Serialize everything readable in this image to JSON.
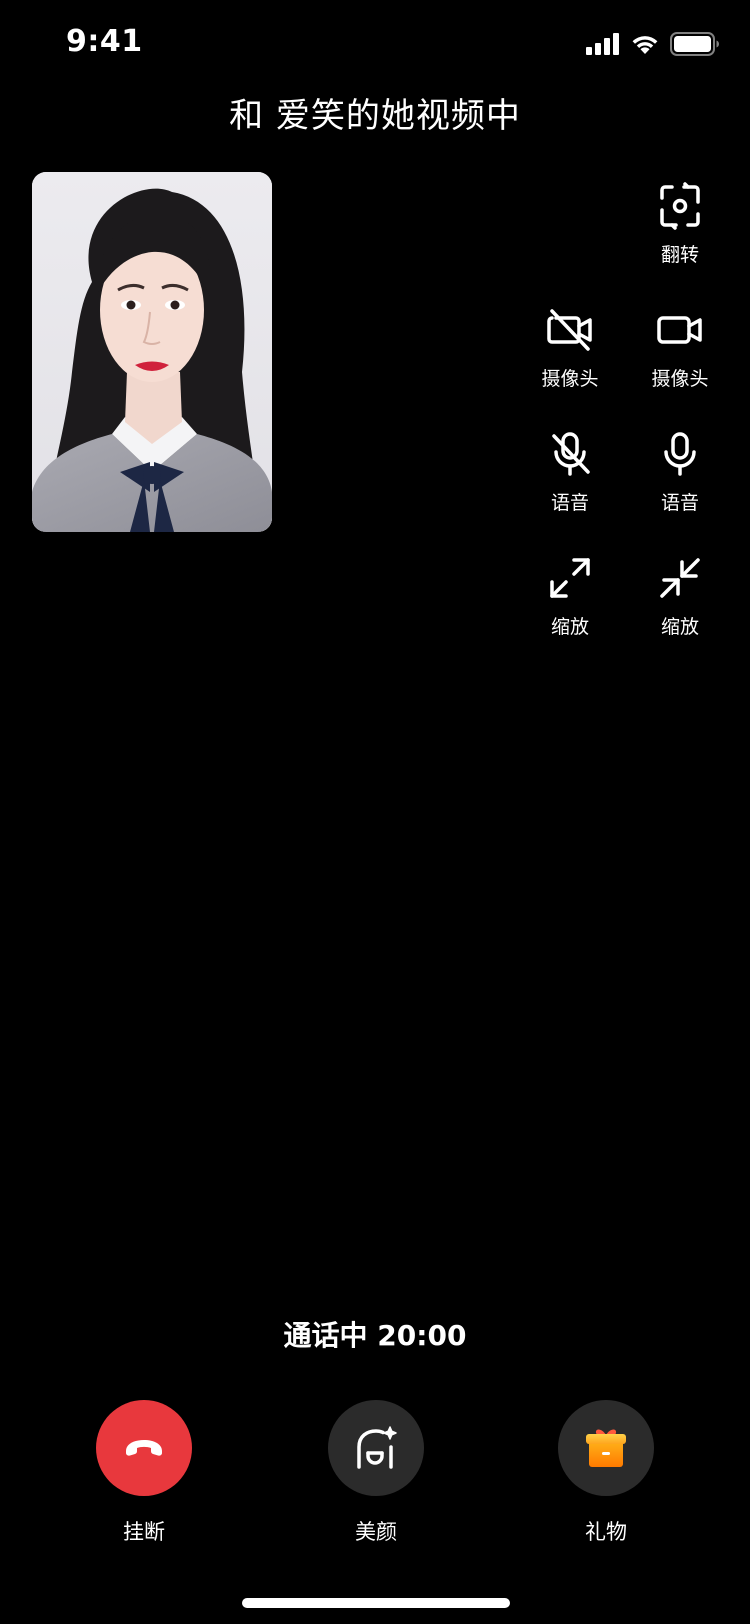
{
  "status_bar": {
    "time": "9:41",
    "icons": [
      "cellular-signal-icon",
      "wifi-icon",
      "battery-icon"
    ]
  },
  "call": {
    "title": "和 爱笑的她视频中",
    "status": "通话中 20:00"
  },
  "controls": {
    "flip": {
      "label": "翻转",
      "icon": "camera-flip-icon"
    },
    "camera_off": {
      "label": "摄像头",
      "icon": "camera-off-icon"
    },
    "camera_on": {
      "label": "摄像头",
      "icon": "camera-icon"
    },
    "mic_off": {
      "label": "语音",
      "icon": "mic-off-icon"
    },
    "mic_on": {
      "label": "语音",
      "icon": "mic-icon"
    },
    "zoom_out": {
      "label": "缩放",
      "icon": "expand-icon"
    },
    "zoom_in": {
      "label": "缩放",
      "icon": "collapse-icon"
    }
  },
  "actions": {
    "hangup": {
      "label": "挂断",
      "color": "#e8383d",
      "icon": "phone-hangup-icon"
    },
    "beauty": {
      "label": "美颜",
      "color": "#2b2b2b",
      "icon": "beauty-icon"
    },
    "gift": {
      "label": "礼物",
      "color": "#2b2b2b",
      "icon": "gift-icon"
    }
  }
}
